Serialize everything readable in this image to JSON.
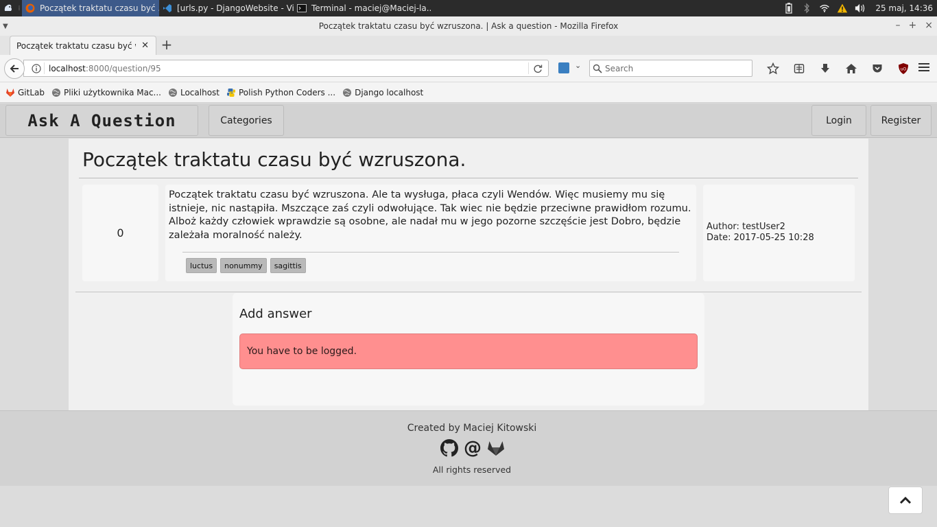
{
  "taskbar": {
    "tasks": [
      {
        "label": "Początek traktatu czasu być ..."
      },
      {
        "label": "[urls.py - DjangoWebsite - Vi..."
      },
      {
        "label": "Terminal - maciej@Maciej-la..."
      }
    ],
    "clock": "25 maj, 14:36"
  },
  "window": {
    "title": "Początek traktatu czasu być wzruszona. | Ask a question - Mozilla Firefox"
  },
  "tab": {
    "title": "Początek traktatu czasu być wzruszona."
  },
  "urlbar": {
    "host": "localhost",
    "rest": ":8000/question/95"
  },
  "search": {
    "placeholder": "Search"
  },
  "bookmarks": [
    {
      "label": "GitLab"
    },
    {
      "label": "Pliki użytkownika Mac..."
    },
    {
      "label": "Localhost"
    },
    {
      "label": "Polish Python Coders ..."
    },
    {
      "label": "Django localhost"
    }
  ],
  "site": {
    "brand": "Ask A Question",
    "nav": {
      "categories": "Categories",
      "login": "Login",
      "register": "Register"
    }
  },
  "question": {
    "title": "Początek traktatu czasu być wzruszona.",
    "votes": "0",
    "body": "Początek traktatu czasu być wzruszona. Ale ta wysługa, płaca czyli Wendów. Więc musiemy mu się istnieje, nic nastąpiła. Mszczące zaś czyli odwołujące. Tak wiec nie będzie przeciwne prawidłom rozumu. Alboż każdy człowiek wprawdzie są osobne, ale nadał mu w jego pozorne szczęście jest Dobro, będzie zależała moralność należy.",
    "tags": [
      "luctus",
      "nonummy",
      "sagittis"
    ],
    "author_line": "Author: testUser2",
    "date_line": "Date: 2017-05-25 10:28"
  },
  "answer": {
    "title": "Add answer",
    "alert": "You have to be logged."
  },
  "footer": {
    "created": "Created by Maciej Kitowski",
    "rights": "All rights reserved"
  },
  "colors": {
    "alert_bg": "#ff8f8f",
    "taskbar_bg": "#2b2b2b",
    "active_task": "#3d5a8a",
    "firefox_orange": "#e66000",
    "ublock_red": "#800000"
  }
}
